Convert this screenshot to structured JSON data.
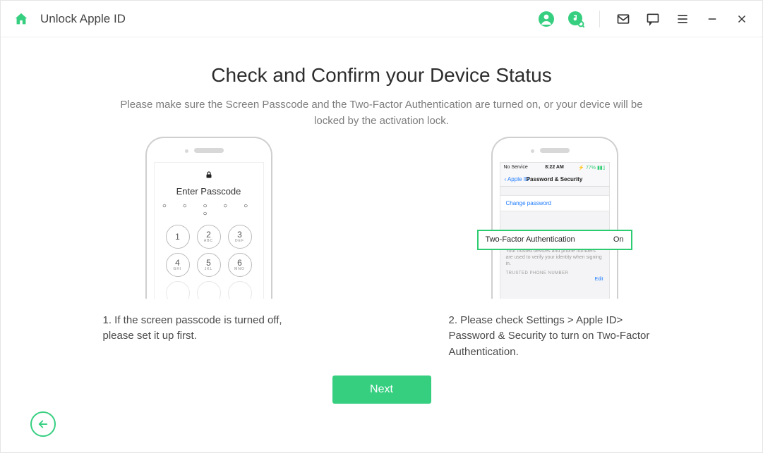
{
  "app_title": "Unlock Apple ID",
  "heading": "Check and Confirm your Device Status",
  "subheading": "Please make sure the Screen Passcode and the Two-Factor Authentication are turned on, or your device will be locked by the activation lock.",
  "left": {
    "enter_passcode": "Enter Passcode",
    "keypad": {
      "k1": "1",
      "k2": "2",
      "k2s": "ABC",
      "k3": "3",
      "k3s": "DEF",
      "k4": "4",
      "k4s": "GHI",
      "k5": "5",
      "k5s": "JKL",
      "k6": "6",
      "k6s": "MNO"
    },
    "caption": "1. If the screen passcode is turned off, please set it up first."
  },
  "right": {
    "status": {
      "carrier": "No Service",
      "time": "8:22 AM",
      "battery": "77%"
    },
    "nav_back": "Apple ID",
    "nav_title": "Password & Security",
    "change_password": "Change password",
    "tfa_label": "Two-Factor Authentication",
    "tfa_value": "On",
    "trusted_note": "Your trusted devices and phone numbers are used to verify your identity when signing in.",
    "trusted_head": "TRUSTED PHONE NUMBER",
    "edit": "Edit",
    "caption": "2. Please check Settings > Apple ID> Password & Security to turn on Two-Factor Authentication."
  },
  "buttons": {
    "next": "Next"
  },
  "colors": {
    "accent": "#36cf80"
  }
}
